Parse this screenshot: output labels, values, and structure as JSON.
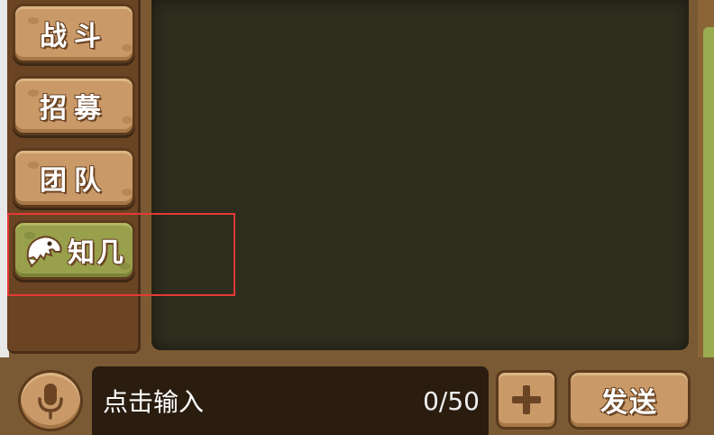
{
  "sidebar": {
    "tabs": [
      {
        "label": "战斗",
        "active": false
      },
      {
        "label": "招募",
        "active": false
      },
      {
        "label": "团队",
        "active": false
      },
      {
        "label": "知几",
        "active": true,
        "icon": "dino-icon"
      }
    ]
  },
  "input": {
    "placeholder": "点击输入",
    "counter": "0/50"
  },
  "buttons": {
    "mic_icon": "mic-icon",
    "plus_icon": "plus-icon",
    "send_label": "发送"
  },
  "colors": {
    "tab_brown": "#c99a68",
    "tab_active_green": "#98a04c",
    "chat_bg": "#2f2d1e",
    "frame_brown": "#7a5a34",
    "highlight_red": "#e53935"
  }
}
